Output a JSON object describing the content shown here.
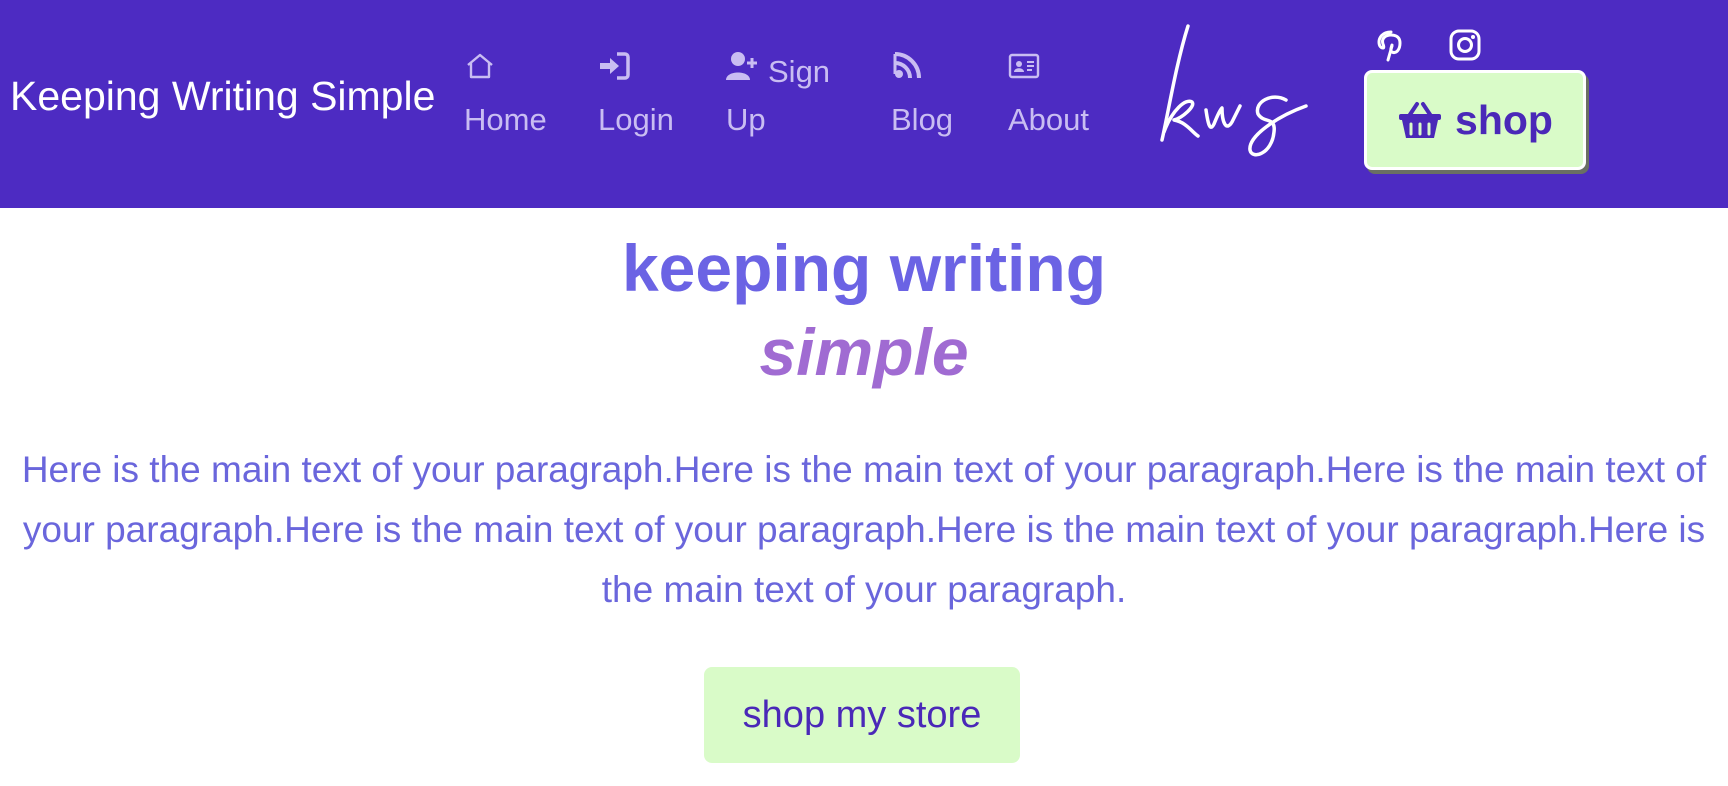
{
  "navbar": {
    "brand": "Keeping Writing Simple",
    "items": [
      {
        "label": "Home",
        "icon": "home-icon"
      },
      {
        "label": "Login",
        "icon": "login-icon"
      },
      {
        "label_first": "Sign",
        "label_second": "Up",
        "icon": "user-plus-icon"
      },
      {
        "label": "Blog",
        "icon": "rss-icon"
      },
      {
        "label": "About",
        "icon": "id-card-icon"
      }
    ],
    "social": [
      "pinterest-icon",
      "instagram-icon"
    ],
    "shop_label": "shop",
    "logo_icon": "kws-logo"
  },
  "hero": {
    "title": "keeping writing",
    "subtitle": "simple",
    "paragraph": "Here is the main text of your paragraph.Here is the main text of your paragraph.Here is the main text of your paragraph.Here is the main text of your paragraph.Here is the main text of your paragraph.Here is the main text of your paragraph.",
    "button_label": "shop my store"
  },
  "colors": {
    "navbar": "#4d2bc2",
    "accent_green": "#d9fbc8",
    "title": "#6b63e4",
    "subtitle": "#a06bd2",
    "text": "#6a66dc"
  }
}
